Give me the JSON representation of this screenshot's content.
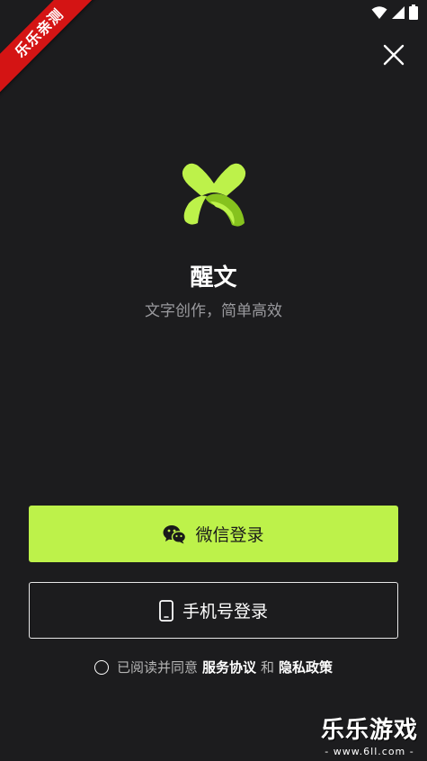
{
  "watermark": {
    "ribbon_text": "乐乐亲测",
    "site_title": "乐乐游戏",
    "site_url": "- www.6ll.com -"
  },
  "status_bar": {
    "icons": [
      "wifi-icon",
      "signal-icon",
      "battery-icon"
    ]
  },
  "app": {
    "name": "醒文",
    "slogan": "文字创作，简单高效",
    "logo_icon": "xingwen-logo-icon",
    "accent_color": "#bdf24a"
  },
  "login": {
    "wechat_label": "微信登录",
    "wechat_icon": "wechat-icon",
    "phone_label": "手机号登录",
    "phone_icon": "phone-icon"
  },
  "agreement": {
    "prefix": "已阅读并同意",
    "service_link": "服务协议",
    "conjunction": "和",
    "privacy_link": "隐私政策"
  }
}
